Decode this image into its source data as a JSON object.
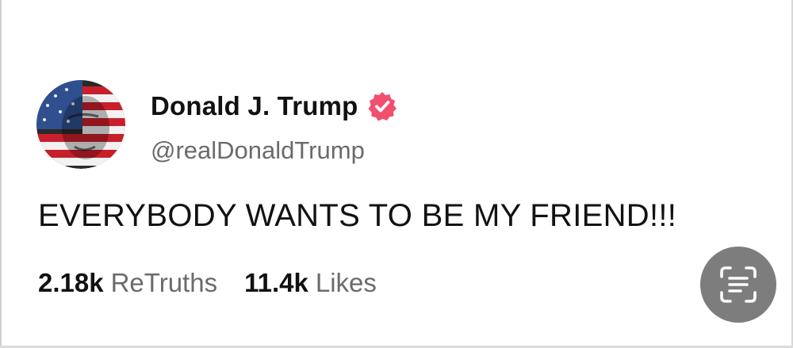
{
  "post": {
    "author": {
      "display_name": "Donald J. Trump",
      "handle": "@realDonaldTrump",
      "verified_color": "#f0506e"
    },
    "text": "EVERYBODY WANTS TO BE MY FRIEND!!!",
    "stats": {
      "retruths_count": "2.18k",
      "retruths_label": "ReTruths",
      "likes_count": "11.4k",
      "likes_label": "Likes"
    }
  },
  "overlay": {
    "icon": "text-scan-icon",
    "background": "#7d7d7d"
  }
}
